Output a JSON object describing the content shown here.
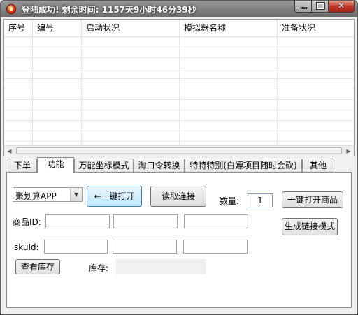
{
  "window": {
    "title": "登陆成功! 剩余时间: 1157天9小时46分39秒"
  },
  "table": {
    "columns": [
      "序号",
      "编号",
      "启动状况",
      "模拟器名称",
      "准备状况"
    ],
    "rows": []
  },
  "tabs": [
    "下单",
    "功能",
    "万能坐标模式",
    "淘口令转换",
    "特特特别(白嫖项目随时会砍)",
    "其他"
  ],
  "active_tab": "功能",
  "panel": {
    "app_select": "聚划算APP",
    "open_button": "←一键打开",
    "read_button": "读取连接",
    "qty_label": "数量:",
    "qty_value": "1",
    "open_goods_button": "一键打开商品",
    "goods_id_label": "商品ID:",
    "gen_link_button": "生成链接模式",
    "sku_label": "skuId:",
    "check_stock_button": "查看库存",
    "stock_label": "库存:",
    "stock_value": ""
  },
  "icons": {
    "app": "app-icon",
    "minimize": "minimize-icon",
    "maximize": "maximize-icon",
    "close": "close-icon",
    "scroll_left": "chevron-left-icon",
    "scroll_right": "chevron-right-icon",
    "dropdown": "chevron-down-icon"
  }
}
